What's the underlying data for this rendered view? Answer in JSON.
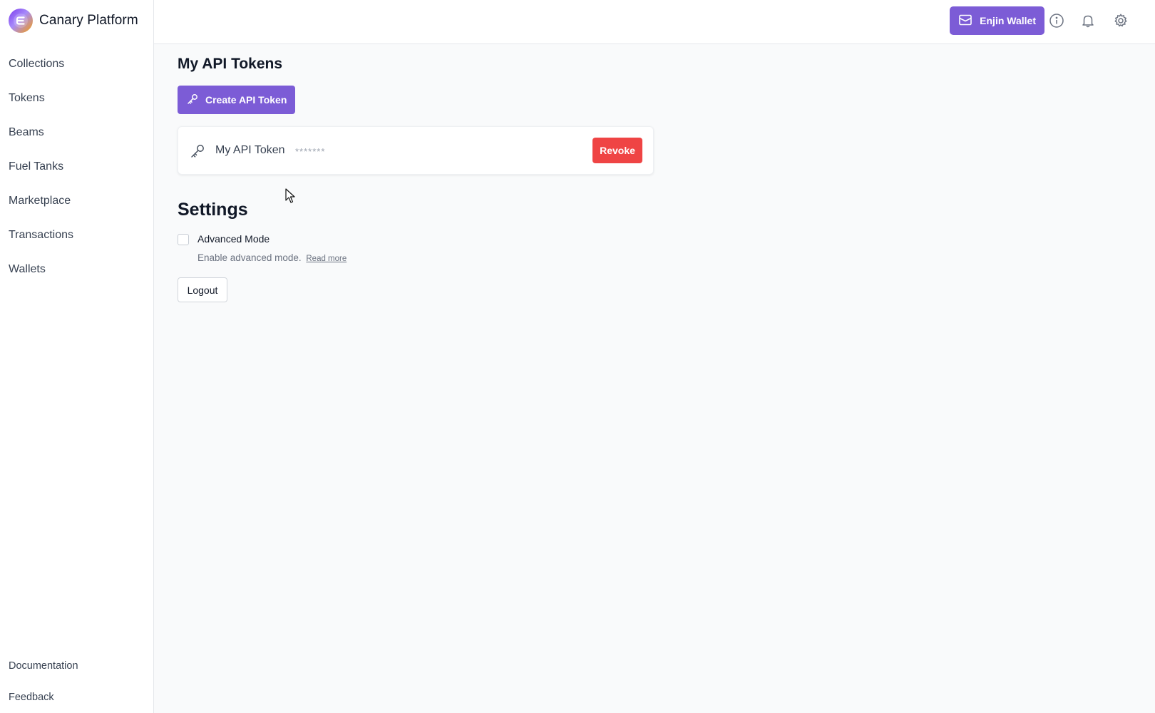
{
  "app": {
    "name": "Canary Platform",
    "logo_icon": "enjin-logo-icon",
    "accent_color": "#7c5cd6",
    "danger_color": "#ef4444"
  },
  "sidebar": {
    "items": [
      {
        "label": "Collections"
      },
      {
        "label": "Tokens"
      },
      {
        "label": "Beams"
      },
      {
        "label": "Fuel Tanks"
      },
      {
        "label": "Marketplace"
      },
      {
        "label": "Transactions"
      },
      {
        "label": "Wallets"
      }
    ],
    "footer": [
      {
        "label": "Documentation"
      },
      {
        "label": "Feedback"
      }
    ]
  },
  "topbar": {
    "wallet_button": {
      "label": "Enjin Wallet",
      "icon": "wallet-icon"
    },
    "icons": [
      "info-icon",
      "bell-icon",
      "gear-icon"
    ]
  },
  "api_tokens": {
    "title": "My API Tokens",
    "create_button": {
      "label": "Create API Token",
      "icon": "key-icon"
    },
    "tokens": [
      {
        "name": "My API Token",
        "masked_value": "*******",
        "revoke_label": "Revoke"
      }
    ]
  },
  "settings": {
    "title": "Settings",
    "advanced_mode": {
      "label": "Advanced Mode",
      "checked": false,
      "description": "Enable advanced mode.",
      "link": "Read more"
    },
    "logout_label": "Logout"
  }
}
